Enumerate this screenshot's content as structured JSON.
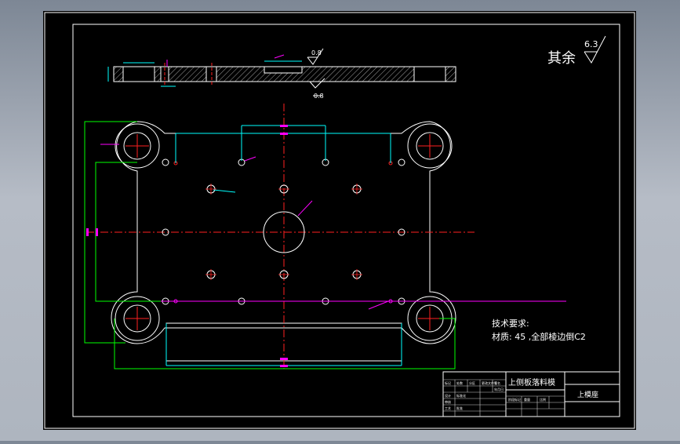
{
  "roughness": {
    "other_label": "其余",
    "other_value": "6.3",
    "top_callout": "0.8",
    "bottom_callout": "0.8"
  },
  "tech_requirements": {
    "heading": "技术要求:",
    "material_line": "材质: 45 ,全部棱边倒C2"
  },
  "title_block": {
    "drawing_title": "上侧板落料模",
    "part_name": "上模座",
    "small_labels": [
      "标记",
      "处数",
      "分区",
      "更改文件号",
      "签名",
      "年月日",
      "设计",
      "标准化",
      "审核",
      "工艺",
      "批准",
      "阶段标记",
      "重量",
      "比例"
    ]
  },
  "colors": {
    "background": "#000000",
    "frame": "#ffffff",
    "centerline": "#ff2020",
    "dimension": "#00ffff",
    "extension": "#00ff00",
    "leader": "#ff00ff",
    "bolt": "#ffff00"
  }
}
